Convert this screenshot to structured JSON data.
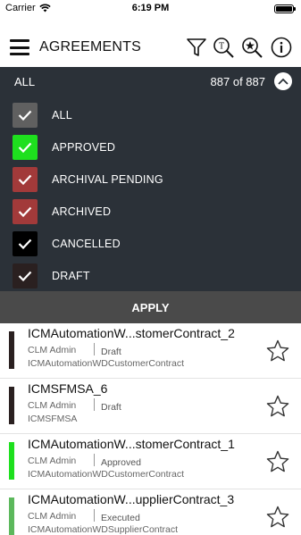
{
  "status_bar": {
    "carrier": "Carrier",
    "time": "6:19 PM"
  },
  "header": {
    "title": "AGREEMENTS",
    "icons": [
      "menu-icon",
      "filter-icon",
      "text-search-icon",
      "advanced-search-icon",
      "info-icon"
    ]
  },
  "filter": {
    "all_label": "ALL",
    "count_label": "887 of 887",
    "options": [
      {
        "label": "ALL",
        "color": "#606060",
        "checked": true
      },
      {
        "label": "APPROVED",
        "color": "#1ee01e",
        "checked": true
      },
      {
        "label": "ARCHIVAL PENDING",
        "color": "#a23a3a",
        "checked": true
      },
      {
        "label": "ARCHIVED",
        "color": "#a23a3a",
        "checked": true
      },
      {
        "label": "CANCELLED",
        "color": "#000000",
        "checked": true
      },
      {
        "label": "DRAFT",
        "color": "#2a2020",
        "checked": true
      }
    ],
    "apply_label": "APPLY"
  },
  "agreements": [
    {
      "name": "ICMAutomationW...stomerContract_2",
      "owner": "CLM Admin",
      "status": "Draft",
      "type": "ICMAutomationWDCustomerContract",
      "color": "#2a2020"
    },
    {
      "name": "ICMSFMSA_6",
      "owner": "CLM Admin",
      "status": "Draft",
      "type": "ICMSFMSA",
      "color": "#2a2020"
    },
    {
      "name": "ICMAutomationW...stomerContract_1",
      "owner": "CLM Admin",
      "status": "Approved",
      "type": "ICMAutomationWDCustomerContract",
      "color": "#1ee01e"
    },
    {
      "name": "ICMAutomationW...upplierContract_3",
      "owner": "CLM Admin",
      "status": "Executed",
      "type": "ICMAutomationWDSupplierContract",
      "color": "#5cb85c"
    }
  ]
}
